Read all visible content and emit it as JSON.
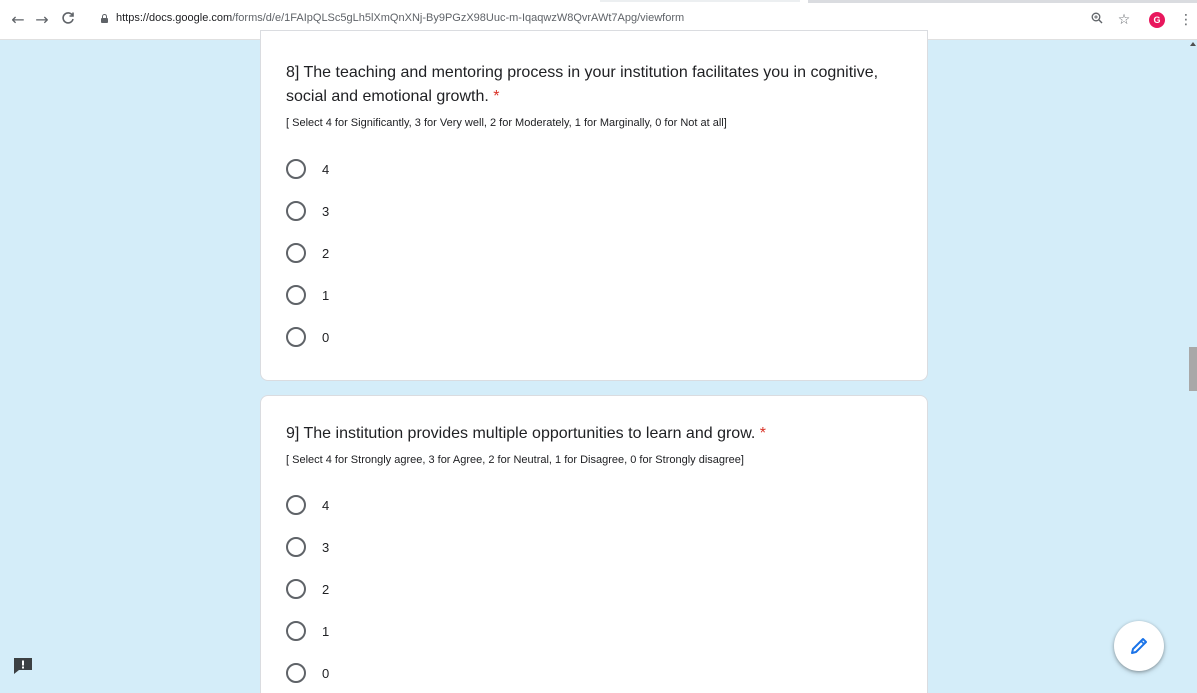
{
  "browser": {
    "url_domain": "https://docs.google.com",
    "url_path": "/forms/d/e/1FAIpQLSc5gLh5lXmQnXNj-By9PGzX98Uuc-m-IqaqwzW8QvrAWt7Apg/viewform",
    "avatar_letter": "G",
    "avatar_color": "#e8175d",
    "icons": [
      "back-icon",
      "forward-icon",
      "reload-icon",
      "lock-icon",
      "zoom-icon",
      "star-icon",
      "menu-icon"
    ]
  },
  "questions": [
    {
      "title": "8] The teaching and mentoring process in your institution facilitates you in cognitive, social and emotional growth.",
      "required_mark": "*",
      "description": "[ Select 4 for Significantly, 3 for Very well, 2 for Moderately, 1 for Marginally, 0 for Not at all]",
      "options": [
        "4",
        "3",
        "2",
        "1",
        "0"
      ]
    },
    {
      "title": "9] The institution provides multiple opportunities to learn and grow.",
      "required_mark": "*",
      "description": "[ Select 4 for Strongly agree, 3 for Agree, 2 for Neutral, 1 for Disagree, 0 for Strongly disagree]",
      "options": [
        "4",
        "3",
        "2",
        "1",
        "0"
      ]
    }
  ],
  "theme": {
    "background": "#d4edf9",
    "required": "#d93025",
    "accent": "#1a73e8"
  }
}
